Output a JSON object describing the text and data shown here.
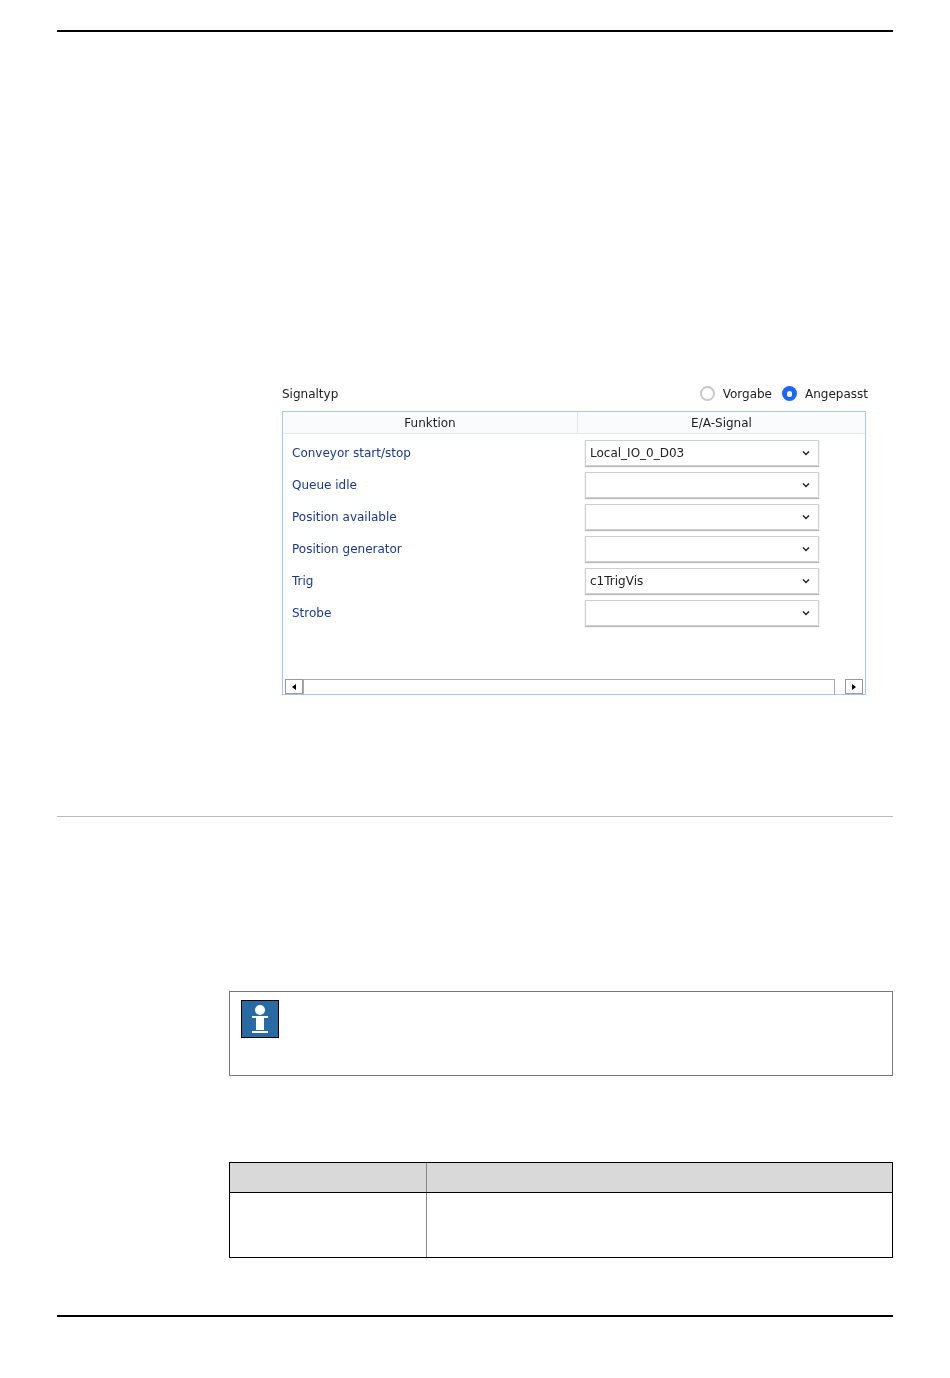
{
  "signal_panel": {
    "label": "Signaltyp",
    "options": [
      {
        "label": "Vorgabe",
        "selected": false
      },
      {
        "label": "Angepasst",
        "selected": true
      }
    ],
    "columns": [
      "Funktion",
      "E/A-Signal"
    ],
    "rows": [
      {
        "function": "Conveyor start/stop",
        "signal": "Local_IO_0_D03"
      },
      {
        "function": "Queue idle"
      },
      {
        "function": "Position available"
      },
      {
        "function": "Position generator"
      },
      {
        "function": "Trig",
        "signal": "c1TrigVis"
      },
      {
        "function": "Strobe"
      }
    ]
  }
}
